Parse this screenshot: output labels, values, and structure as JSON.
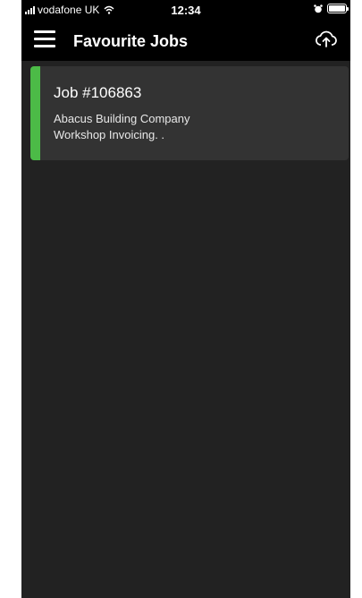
{
  "status_bar": {
    "carrier": "vodafone UK",
    "time": "12:34",
    "icons": [
      "signal-icon",
      "wifi-icon",
      "alarm-icon",
      "battery-icon"
    ]
  },
  "app_bar": {
    "title": "Favourite Jobs",
    "menu_icon": "hamburger-menu-icon",
    "upload_icon": "cloud-upload-icon"
  },
  "jobs": [
    {
      "title": "Job #106863",
      "company": "Abacus Building Company",
      "description": "Workshop Invoicing. .",
      "accent_color": "#4cbb47"
    }
  ],
  "colors": {
    "background": "#222222",
    "bar": "#000000",
    "card": "#333333",
    "text": "#ffffff"
  }
}
